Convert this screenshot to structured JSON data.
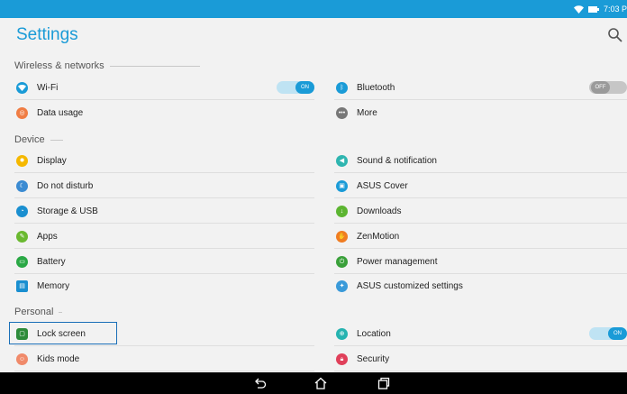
{
  "status": {
    "time": "7:03 P"
  },
  "header": {
    "title": "Settings"
  },
  "sections": {
    "wireless": "Wireless & networks",
    "device": "Device",
    "personal": "Personal"
  },
  "wireless": {
    "wifi": {
      "label": "Wi-Fi",
      "toggle": "ON"
    },
    "bluetooth": {
      "label": "Bluetooth",
      "toggle": "OFF"
    },
    "data_usage": {
      "label": "Data usage"
    },
    "more": {
      "label": "More"
    }
  },
  "device": {
    "display": "Display",
    "sound": "Sound & notification",
    "dnd": "Do not disturb",
    "asus_cover": "ASUS Cover",
    "storage": "Storage & USB",
    "downloads": "Downloads",
    "apps": "Apps",
    "zenmotion": "ZenMotion",
    "battery": "Battery",
    "power": "Power management",
    "memory": "Memory",
    "asus_custom": "ASUS customized settings"
  },
  "personal": {
    "lock_screen": "Lock screen",
    "location": {
      "label": "Location",
      "toggle": "ON"
    },
    "kids_mode": "Kids mode",
    "security": "Security"
  },
  "colors": {
    "accent": "#1a9bd7",
    "status_bar": "#1a9bd7",
    "nav_bar": "#000000"
  }
}
